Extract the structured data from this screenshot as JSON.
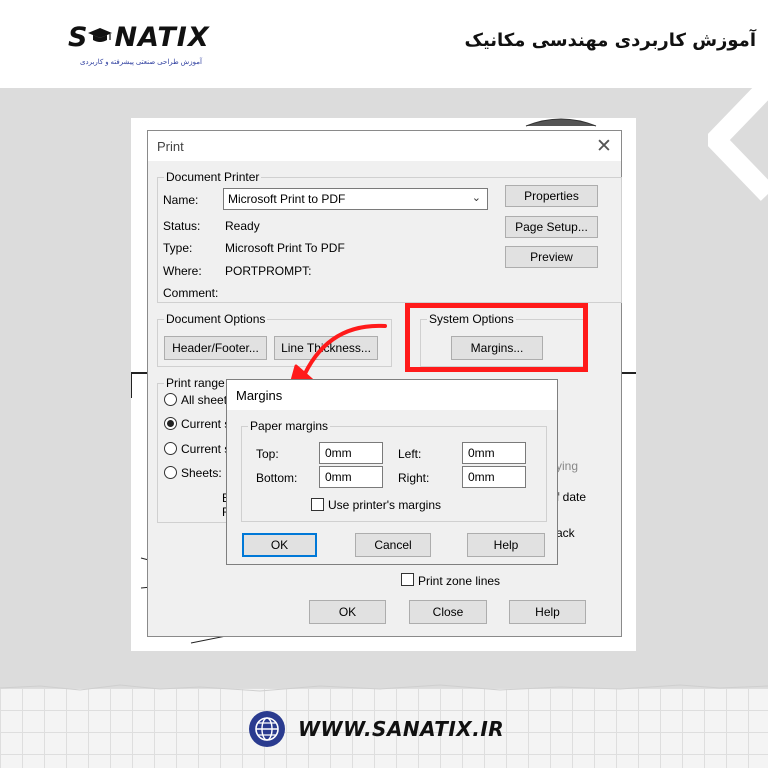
{
  "poster": {
    "brand": {
      "wordmark_left": "S",
      "wordmark_right": "NATIX",
      "tagline": "آموزش طراحی صنعتی پیشرفته و کاربردی"
    },
    "headline": "آموزش کاربردی مهندسی مکانیک",
    "website": "WWW.SANATIX.IR",
    "colors": {
      "highlight": "#ff1a1a",
      "globe": "#2a3b8f",
      "page_bg": "#dcdcdc"
    }
  },
  "print_dialog": {
    "title": "Print",
    "close_icon": "close-icon",
    "document_printer": {
      "legend": "Document Printer",
      "name_label": "Name:",
      "name_value": "Microsoft Print to PDF",
      "status_label": "Status:",
      "status_value": "Ready",
      "type_label": "Type:",
      "type_value": "Microsoft Print To PDF",
      "where_label": "Where:",
      "where_value": "PORTPROMPT:",
      "comment_label": "Comment:",
      "properties_button": "Properties",
      "page_setup_button": "Page Setup...",
      "preview_button": "Preview"
    },
    "document_options": {
      "legend": "Document Options",
      "header_footer_button": "Header/Footer...",
      "line_thickness_button": "Line Thickness..."
    },
    "system_options": {
      "legend": "System Options",
      "margins_button": "Margins..."
    },
    "print_range": {
      "legend": "Print range",
      "all_sheets": "All sheets",
      "current_sheet": "Current s",
      "current_screen": "Current s",
      "sheets": "Sheets:",
      "partial_e": "E",
      "partial_f": "F"
    },
    "right_partial": {
      "ing": "ying",
      "of_date": "f date",
      "ack": "ack"
    },
    "print_zone_lines": "Print zone lines",
    "ok_button": "OK",
    "close_button": "Close",
    "help_button": "Help"
  },
  "margins_dialog": {
    "title": "Margins",
    "legend": "Paper margins",
    "top_label": "Top:",
    "top_value": "0mm",
    "left_label": "Left:",
    "left_value": "0mm",
    "bottom_label": "Bottom:",
    "bottom_value": "0mm",
    "right_label": "Right:",
    "right_value": "0mm",
    "use_printer_margins": "Use printer's margins",
    "ok_button": "OK",
    "cancel_button": "Cancel",
    "help_button": "Help"
  }
}
